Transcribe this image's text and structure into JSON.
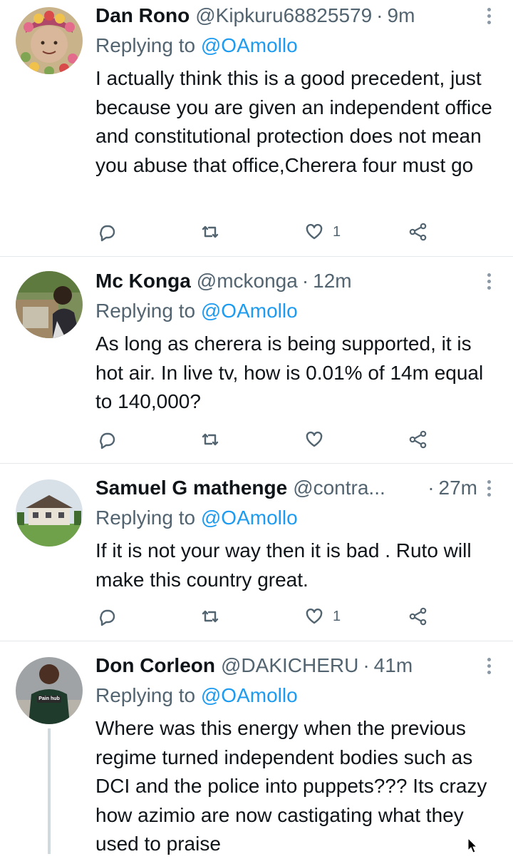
{
  "tweets": [
    {
      "name": "Dan Rono",
      "handle": "@Kipkuru68825579",
      "time": "9m",
      "replying_prefix": "Replying to",
      "replying_to": "@OAmollo",
      "text": "I actually think this is a good precedent, just because you are given an independent office and constitutional protection does not mean you abuse that office,Cherera four must go",
      "likes": "1"
    },
    {
      "name": "Mc Konga",
      "handle": "@mckonga",
      "time": "12m",
      "replying_prefix": "Replying to",
      "replying_to": "@OAmollo",
      "text": "As long as cherera is being supported, it is hot air. In live tv, how is 0.01% of 14m equal to 140,000?",
      "likes": ""
    },
    {
      "name": "Samuel G mathenge",
      "handle": "@contra...",
      "time": "27m",
      "replying_prefix": "Replying to",
      "replying_to": "@OAmollo",
      "text": "If it is not your way then it is bad . Ruto will make this country great.",
      "likes": "1"
    },
    {
      "name": "Don Corleon",
      "handle": "@DAKICHERU",
      "time": "41m",
      "replying_prefix": "Replying to",
      "replying_to": "@OAmollo",
      "text": "Where was this energy when the previous regime turned independent bodies such as DCI and  the police into puppets??? Its crazy how azimio are now castigating what they used to praise",
      "avatar_shirt_text": "Pain hub"
    }
  ],
  "separator": "·",
  "icons": {
    "reply": "reply-icon",
    "retweet": "retweet-icon",
    "like": "heart-icon",
    "share": "share-icon",
    "more": "more-options-icon"
  },
  "colors": {
    "accent": "#1d9bf0",
    "secondary_text": "#536471",
    "divider": "#e6e9eb"
  }
}
